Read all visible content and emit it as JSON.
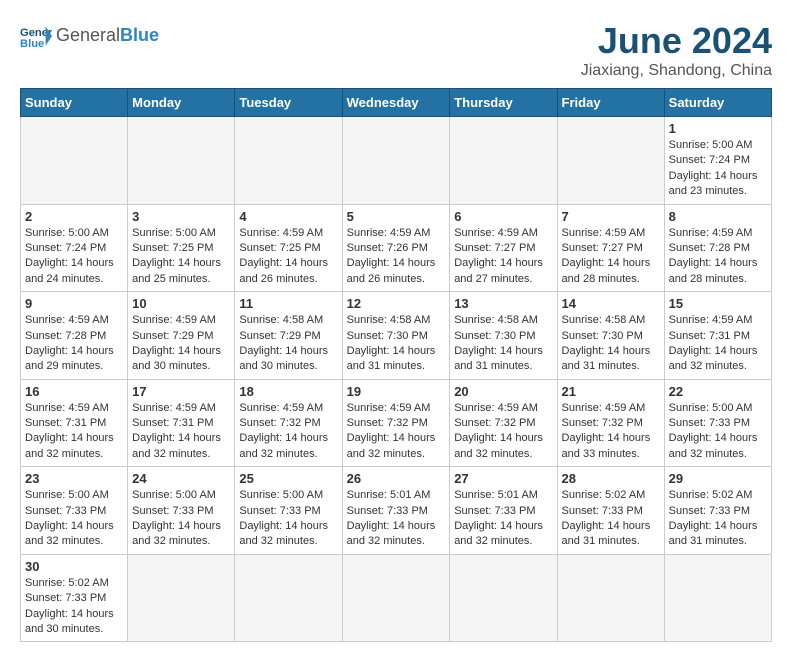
{
  "header": {
    "logo_general": "General",
    "logo_blue": "Blue",
    "month_title": "June 2024",
    "location": "Jiaxiang, Shandong, China"
  },
  "weekdays": [
    "Sunday",
    "Monday",
    "Tuesday",
    "Wednesday",
    "Thursday",
    "Friday",
    "Saturday"
  ],
  "weeks": [
    [
      {
        "day": "",
        "info": ""
      },
      {
        "day": "",
        "info": ""
      },
      {
        "day": "",
        "info": ""
      },
      {
        "day": "",
        "info": ""
      },
      {
        "day": "",
        "info": ""
      },
      {
        "day": "",
        "info": ""
      },
      {
        "day": "1",
        "sunrise": "Sunrise: 5:00 AM",
        "sunset": "Sunset: 7:24 PM",
        "daylight": "Daylight: 14 hours and 23 minutes."
      }
    ],
    [
      {
        "day": "2",
        "sunrise": "Sunrise: 5:00 AM",
        "sunset": "Sunset: 7:24 PM",
        "daylight": "Daylight: 14 hours and 24 minutes."
      },
      {
        "day": "3",
        "sunrise": "Sunrise: 5:00 AM",
        "sunset": "Sunset: 7:25 PM",
        "daylight": "Daylight: 14 hours and 25 minutes."
      },
      {
        "day": "4",
        "sunrise": "Sunrise: 4:59 AM",
        "sunset": "Sunset: 7:25 PM",
        "daylight": "Daylight: 14 hours and 26 minutes."
      },
      {
        "day": "5",
        "sunrise": "Sunrise: 4:59 AM",
        "sunset": "Sunset: 7:26 PM",
        "daylight": "Daylight: 14 hours and 26 minutes."
      },
      {
        "day": "6",
        "sunrise": "Sunrise: 4:59 AM",
        "sunset": "Sunset: 7:27 PM",
        "daylight": "Daylight: 14 hours and 27 minutes."
      },
      {
        "day": "7",
        "sunrise": "Sunrise: 4:59 AM",
        "sunset": "Sunset: 7:27 PM",
        "daylight": "Daylight: 14 hours and 28 minutes."
      },
      {
        "day": "8",
        "sunrise": "Sunrise: 4:59 AM",
        "sunset": "Sunset: 7:28 PM",
        "daylight": "Daylight: 14 hours and 28 minutes."
      }
    ],
    [
      {
        "day": "9",
        "sunrise": "Sunrise: 4:59 AM",
        "sunset": "Sunset: 7:28 PM",
        "daylight": "Daylight: 14 hours and 29 minutes."
      },
      {
        "day": "10",
        "sunrise": "Sunrise: 4:59 AM",
        "sunset": "Sunset: 7:29 PM",
        "daylight": "Daylight: 14 hours and 30 minutes."
      },
      {
        "day": "11",
        "sunrise": "Sunrise: 4:58 AM",
        "sunset": "Sunset: 7:29 PM",
        "daylight": "Daylight: 14 hours and 30 minutes."
      },
      {
        "day": "12",
        "sunrise": "Sunrise: 4:58 AM",
        "sunset": "Sunset: 7:30 PM",
        "daylight": "Daylight: 14 hours and 31 minutes."
      },
      {
        "day": "13",
        "sunrise": "Sunrise: 4:58 AM",
        "sunset": "Sunset: 7:30 PM",
        "daylight": "Daylight: 14 hours and 31 minutes."
      },
      {
        "day": "14",
        "sunrise": "Sunrise: 4:58 AM",
        "sunset": "Sunset: 7:30 PM",
        "daylight": "Daylight: 14 hours and 31 minutes."
      },
      {
        "day": "15",
        "sunrise": "Sunrise: 4:59 AM",
        "sunset": "Sunset: 7:31 PM",
        "daylight": "Daylight: 14 hours and 32 minutes."
      }
    ],
    [
      {
        "day": "16",
        "sunrise": "Sunrise: 4:59 AM",
        "sunset": "Sunset: 7:31 PM",
        "daylight": "Daylight: 14 hours and 32 minutes."
      },
      {
        "day": "17",
        "sunrise": "Sunrise: 4:59 AM",
        "sunset": "Sunset: 7:31 PM",
        "daylight": "Daylight: 14 hours and 32 minutes."
      },
      {
        "day": "18",
        "sunrise": "Sunrise: 4:59 AM",
        "sunset": "Sunset: 7:32 PM",
        "daylight": "Daylight: 14 hours and 32 minutes."
      },
      {
        "day": "19",
        "sunrise": "Sunrise: 4:59 AM",
        "sunset": "Sunset: 7:32 PM",
        "daylight": "Daylight: 14 hours and 32 minutes."
      },
      {
        "day": "20",
        "sunrise": "Sunrise: 4:59 AM",
        "sunset": "Sunset: 7:32 PM",
        "daylight": "Daylight: 14 hours and 32 minutes."
      },
      {
        "day": "21",
        "sunrise": "Sunrise: 4:59 AM",
        "sunset": "Sunset: 7:32 PM",
        "daylight": "Daylight: 14 hours and 33 minutes."
      },
      {
        "day": "22",
        "sunrise": "Sunrise: 5:00 AM",
        "sunset": "Sunset: 7:33 PM",
        "daylight": "Daylight: 14 hours and 32 minutes."
      }
    ],
    [
      {
        "day": "23",
        "sunrise": "Sunrise: 5:00 AM",
        "sunset": "Sunset: 7:33 PM",
        "daylight": "Daylight: 14 hours and 32 minutes."
      },
      {
        "day": "24",
        "sunrise": "Sunrise: 5:00 AM",
        "sunset": "Sunset: 7:33 PM",
        "daylight": "Daylight: 14 hours and 32 minutes."
      },
      {
        "day": "25",
        "sunrise": "Sunrise: 5:00 AM",
        "sunset": "Sunset: 7:33 PM",
        "daylight": "Daylight: 14 hours and 32 minutes."
      },
      {
        "day": "26",
        "sunrise": "Sunrise: 5:01 AM",
        "sunset": "Sunset: 7:33 PM",
        "daylight": "Daylight: 14 hours and 32 minutes."
      },
      {
        "day": "27",
        "sunrise": "Sunrise: 5:01 AM",
        "sunset": "Sunset: 7:33 PM",
        "daylight": "Daylight: 14 hours and 32 minutes."
      },
      {
        "day": "28",
        "sunrise": "Sunrise: 5:02 AM",
        "sunset": "Sunset: 7:33 PM",
        "daylight": "Daylight: 14 hours and 31 minutes."
      },
      {
        "day": "29",
        "sunrise": "Sunrise: 5:02 AM",
        "sunset": "Sunset: 7:33 PM",
        "daylight": "Daylight: 14 hours and 31 minutes."
      }
    ],
    [
      {
        "day": "30",
        "sunrise": "Sunrise: 5:02 AM",
        "sunset": "Sunset: 7:33 PM",
        "daylight": "Daylight: 14 hours and 30 minutes."
      },
      {
        "day": "",
        "info": ""
      },
      {
        "day": "",
        "info": ""
      },
      {
        "day": "",
        "info": ""
      },
      {
        "day": "",
        "info": ""
      },
      {
        "day": "",
        "info": ""
      },
      {
        "day": "",
        "info": ""
      }
    ]
  ]
}
